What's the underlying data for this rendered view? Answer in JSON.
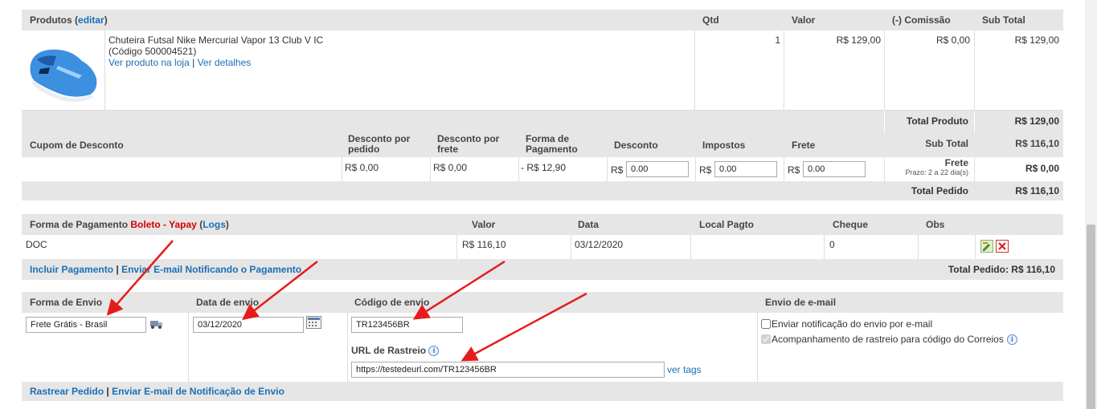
{
  "products": {
    "header": {
      "produtos": "Produtos",
      "editar": "editar",
      "qtd": "Qtd",
      "valor": "Valor",
      "comissao": "(-) Comissão",
      "subtotal": "Sub Total"
    },
    "item": {
      "name": "Chuteira Futsal Nike Mercurial Vapor 13 Club V IC",
      "code": "(Código 500004521)",
      "ver_loja": "Ver produto na loja",
      "separator": "|",
      "ver_detalhes": "Ver detalhes",
      "qtd": "1",
      "valor": "R$ 129,00",
      "comissao": "R$ 0,00",
      "subtotal": "R$ 129,00"
    },
    "total_produto_label": "Total Produto",
    "total_produto_value": "R$ 129,00"
  },
  "discounts": {
    "header": {
      "cupom": "Cupom de Desconto",
      "desc_pedido": "Desconto por pedido",
      "desc_frete": "Desconto por frete",
      "forma_pagamento": "Forma de Pagamento",
      "desconto": "Desconto",
      "impostos": "Impostos",
      "frete": "Frete"
    },
    "subtotal_label": "Sub Total",
    "subtotal_value": "R$ 116,10",
    "desc_pedido_value": "R$ 0,00",
    "desc_frete_value": "R$ 0,00",
    "forma_pagamento_value": "- R$ 12,90",
    "currency": "R$",
    "desconto_input": "0.00",
    "impostos_input": "0.00",
    "frete_input": "0.00",
    "frete_label": "Frete",
    "prazo": "Prazo: 2 a 22 dia(s)",
    "frete_value": "R$ 0,00",
    "total_pedido_label": "Total Pedido",
    "total_pedido_value": "R$ 116,10"
  },
  "payment": {
    "header": {
      "forma": "Forma de Pagamento",
      "method": "Boleto - Yapay",
      "logs": "Logs",
      "valor": "Valor",
      "data": "Data",
      "local": "Local Pagto",
      "cheque": "Cheque",
      "obs": "Obs"
    },
    "row": {
      "type": "DOC",
      "valor": "R$ 116,10",
      "data": "03/12/2020",
      "cheque": "0"
    },
    "incluir": "Incluir Pagamento",
    "enviar": "Enviar E-mail Notificando o Pagamento",
    "total": "Total Pedido: R$ 116,10"
  },
  "shipping": {
    "header": {
      "forma": "Forma de Envio",
      "data": "Data de envio",
      "codigo": "Código de envio",
      "email": "Envio de e-mail"
    },
    "forma_value": "Frete Grátis - Brasil",
    "data_value": "03/12/2020",
    "codigo_value": "TR123456BR",
    "url_label": "URL de Rastreio",
    "url_value": "https://testedeurl.com/TR123456BR",
    "ver_tags": "ver tags",
    "notif_label": "Enviar notificação do envio por e-mail",
    "acomp_label": "Acompanhamento de rastreio para código do Correios",
    "rastrear": "Rastrear Pedido",
    "enviar_notif": "Enviar E-mail de Notificação de Envio"
  },
  "colors": {
    "link": "#1a6fb5",
    "method_red": "#d40000",
    "header_bg": "#e6e6e6",
    "arrow": "#e51c1c"
  }
}
